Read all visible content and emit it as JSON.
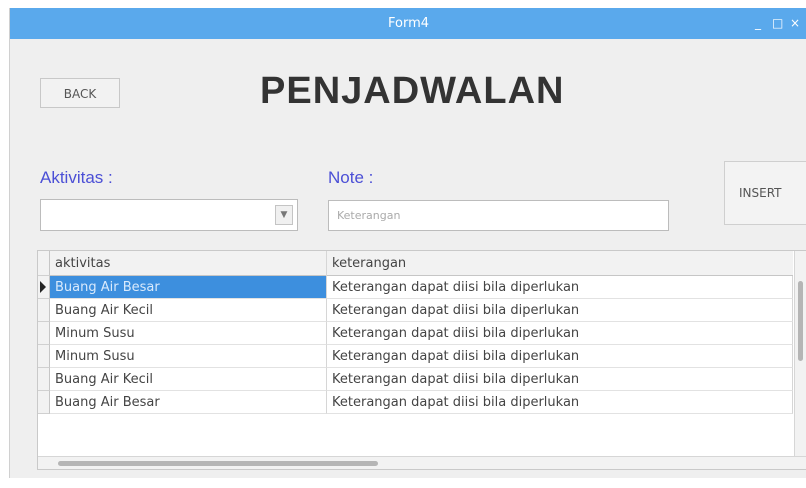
{
  "window": {
    "title": "Form4",
    "controls": [
      "_",
      "□",
      "×"
    ]
  },
  "toolbar": {
    "back_label": "BACK"
  },
  "page": {
    "heading": "PENJADWALAN"
  },
  "form": {
    "aktivitas_label": "Aktivitas :",
    "aktivitas_value": "",
    "note_label": "Note :",
    "note_placeholder": "Keterangan",
    "insert_label": "INSERT"
  },
  "table": {
    "columns": [
      "aktivitas",
      "keterangan"
    ],
    "rows": [
      [
        "Buang Air Besar",
        "Keterangan dapat diisi bila diperlukan"
      ],
      [
        "Buang Air Kecil",
        "Keterangan dapat diisi bila diperlukan"
      ],
      [
        "Minum Susu",
        "Keterangan dapat diisi bila diperlukan"
      ],
      [
        "Minum Susu",
        "Keterangan dapat diisi bila diperlukan"
      ],
      [
        "Buang Air Kecil",
        "Keterangan dapat diisi bila diperlukan"
      ],
      [
        "Buang Air Besar",
        "Keterangan dapat diisi bila diperlukan"
      ]
    ],
    "selected_row": 0
  },
  "colors": {
    "titlebar": "#5aa9ec",
    "label_accent": "#4b4fd6",
    "selection": "#3d8fde"
  }
}
